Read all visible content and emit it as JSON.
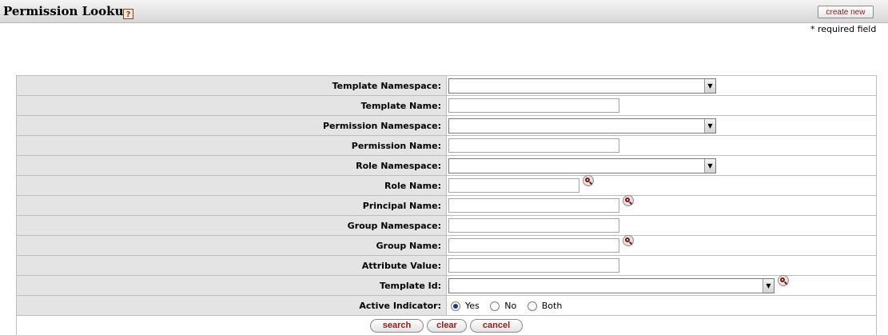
{
  "header": {
    "title": "Permission Lookup",
    "help_icon_text": "?",
    "create_new_label": "create new"
  },
  "required_note": "* required field",
  "form": {
    "template_namespace": {
      "label": "Template Namespace:",
      "value": ""
    },
    "template_name": {
      "label": "Template Name:",
      "value": ""
    },
    "permission_namespace": {
      "label": "Permission Namespace:",
      "value": ""
    },
    "permission_name": {
      "label": "Permission Name:",
      "value": ""
    },
    "role_namespace": {
      "label": "Role Namespace:",
      "value": ""
    },
    "role_name": {
      "label": "Role Name:",
      "value": ""
    },
    "principal_name": {
      "label": "Principal Name:",
      "value": ""
    },
    "group_namespace": {
      "label": "Group Namespace:",
      "value": ""
    },
    "group_name": {
      "label": "Group Name:",
      "value": ""
    },
    "attribute_value": {
      "label": "Attribute Value:",
      "value": ""
    },
    "template_id": {
      "label": "Template Id:",
      "value": ""
    },
    "active_indicator": {
      "label": "Active Indicator:",
      "options": [
        "Yes",
        "No",
        "Both"
      ],
      "selected": "Yes"
    }
  },
  "buttons": {
    "search": "search",
    "clear": "clear",
    "cancel": "cancel"
  },
  "icons": {
    "help": "help-icon",
    "lookup": "magnifier-lookup-icon",
    "dropdown": "dropdown-arrow-icon"
  },
  "colors": {
    "label_background": "#e4e4e4",
    "button_text": "#8e1d1d",
    "border": "#bdbdbd"
  }
}
